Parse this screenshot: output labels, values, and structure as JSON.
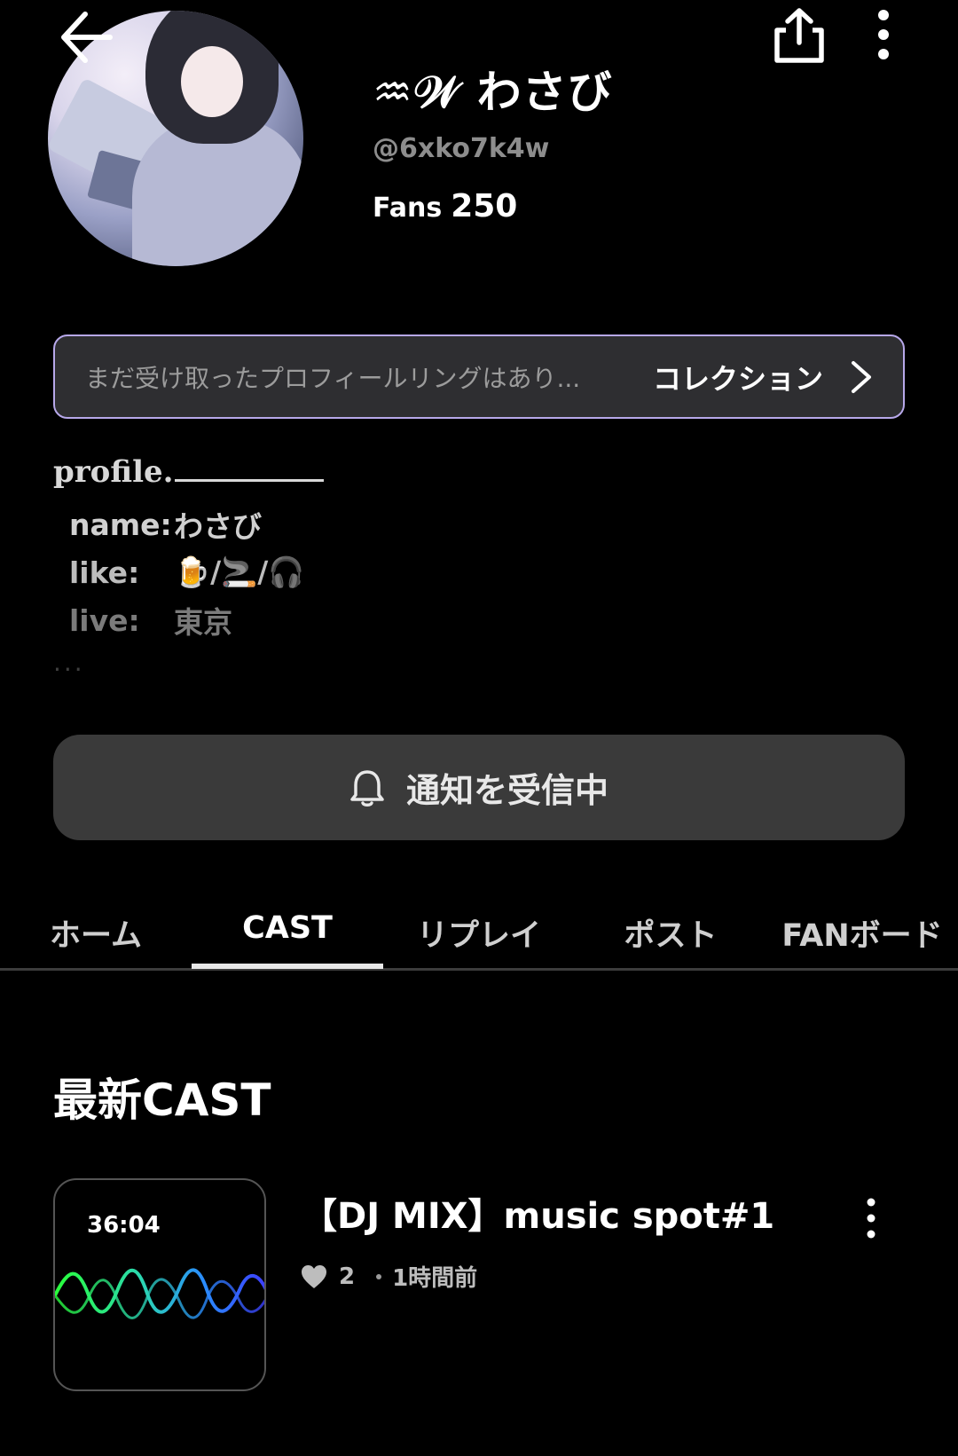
{
  "profile": {
    "display_name": "♒𝒲 わさび",
    "handle": "@6xko7k4w",
    "fans_label": "Fans",
    "fans_count": "250"
  },
  "ring": {
    "text": "まだ受け取ったプロフィールリングはあり...",
    "link_label": "コレクション"
  },
  "bio": {
    "title": "profile.",
    "rows": [
      {
        "key": "name:",
        "value": "わさび"
      },
      {
        "key": "like:",
        "value": "🍺/🚬/🎧"
      },
      {
        "key": "live:",
        "value": "東京"
      }
    ],
    "more": "..."
  },
  "notify": {
    "label": "通知を受信中"
  },
  "tabs": [
    {
      "label": "ホーム",
      "active": false
    },
    {
      "label": "CAST",
      "active": true
    },
    {
      "label": "リプレイ",
      "active": false
    },
    {
      "label": "ポスト",
      "active": false
    },
    {
      "label": "FANボード",
      "active": false
    }
  ],
  "section": {
    "title": "最新CAST"
  },
  "cast": {
    "duration": "36:04",
    "title": "【DJ MIX】music spot#1",
    "likes": "2",
    "time_ago": "1時間前"
  },
  "icons": {
    "back": "back-arrow-icon",
    "share": "share-icon",
    "more": "more-vertical-icon",
    "chevron": "chevron-right-icon",
    "bell": "bell-icon",
    "heart": "heart-icon"
  },
  "colors": {
    "background": "#000000",
    "ring_border": "#b7a8ea",
    "button_bg": "#3a3a3a",
    "tab_underline": "#e8e8e8"
  }
}
